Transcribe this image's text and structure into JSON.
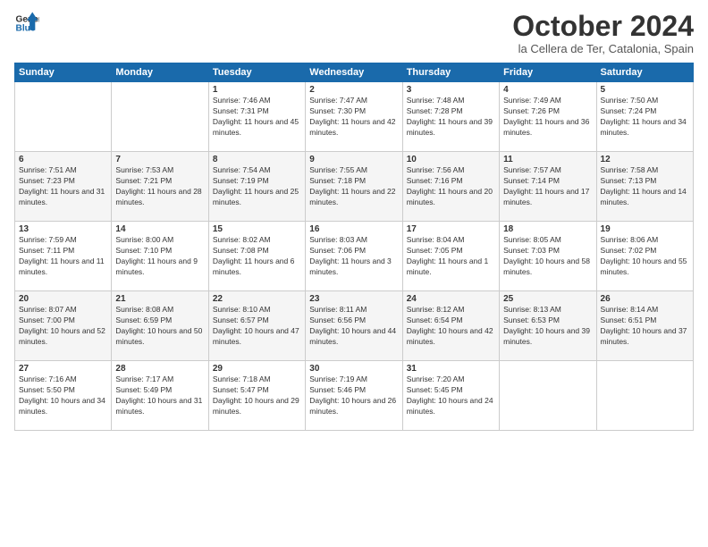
{
  "header": {
    "logo_line1": "General",
    "logo_line2": "Blue",
    "month": "October 2024",
    "location": "la Cellera de Ter, Catalonia, Spain"
  },
  "weekdays": [
    "Sunday",
    "Monday",
    "Tuesday",
    "Wednesday",
    "Thursday",
    "Friday",
    "Saturday"
  ],
  "weeks": [
    [
      {
        "day": "",
        "sunrise": "",
        "sunset": "",
        "daylight": ""
      },
      {
        "day": "",
        "sunrise": "",
        "sunset": "",
        "daylight": ""
      },
      {
        "day": "1",
        "sunrise": "Sunrise: 7:46 AM",
        "sunset": "Sunset: 7:31 PM",
        "daylight": "Daylight: 11 hours and 45 minutes."
      },
      {
        "day": "2",
        "sunrise": "Sunrise: 7:47 AM",
        "sunset": "Sunset: 7:30 PM",
        "daylight": "Daylight: 11 hours and 42 minutes."
      },
      {
        "day": "3",
        "sunrise": "Sunrise: 7:48 AM",
        "sunset": "Sunset: 7:28 PM",
        "daylight": "Daylight: 11 hours and 39 minutes."
      },
      {
        "day": "4",
        "sunrise": "Sunrise: 7:49 AM",
        "sunset": "Sunset: 7:26 PM",
        "daylight": "Daylight: 11 hours and 36 minutes."
      },
      {
        "day": "5",
        "sunrise": "Sunrise: 7:50 AM",
        "sunset": "Sunset: 7:24 PM",
        "daylight": "Daylight: 11 hours and 34 minutes."
      }
    ],
    [
      {
        "day": "6",
        "sunrise": "Sunrise: 7:51 AM",
        "sunset": "Sunset: 7:23 PM",
        "daylight": "Daylight: 11 hours and 31 minutes."
      },
      {
        "day": "7",
        "sunrise": "Sunrise: 7:53 AM",
        "sunset": "Sunset: 7:21 PM",
        "daylight": "Daylight: 11 hours and 28 minutes."
      },
      {
        "day": "8",
        "sunrise": "Sunrise: 7:54 AM",
        "sunset": "Sunset: 7:19 PM",
        "daylight": "Daylight: 11 hours and 25 minutes."
      },
      {
        "day": "9",
        "sunrise": "Sunrise: 7:55 AM",
        "sunset": "Sunset: 7:18 PM",
        "daylight": "Daylight: 11 hours and 22 minutes."
      },
      {
        "day": "10",
        "sunrise": "Sunrise: 7:56 AM",
        "sunset": "Sunset: 7:16 PM",
        "daylight": "Daylight: 11 hours and 20 minutes."
      },
      {
        "day": "11",
        "sunrise": "Sunrise: 7:57 AM",
        "sunset": "Sunset: 7:14 PM",
        "daylight": "Daylight: 11 hours and 17 minutes."
      },
      {
        "day": "12",
        "sunrise": "Sunrise: 7:58 AM",
        "sunset": "Sunset: 7:13 PM",
        "daylight": "Daylight: 11 hours and 14 minutes."
      }
    ],
    [
      {
        "day": "13",
        "sunrise": "Sunrise: 7:59 AM",
        "sunset": "Sunset: 7:11 PM",
        "daylight": "Daylight: 11 hours and 11 minutes."
      },
      {
        "day": "14",
        "sunrise": "Sunrise: 8:00 AM",
        "sunset": "Sunset: 7:10 PM",
        "daylight": "Daylight: 11 hours and 9 minutes."
      },
      {
        "day": "15",
        "sunrise": "Sunrise: 8:02 AM",
        "sunset": "Sunset: 7:08 PM",
        "daylight": "Daylight: 11 hours and 6 minutes."
      },
      {
        "day": "16",
        "sunrise": "Sunrise: 8:03 AM",
        "sunset": "Sunset: 7:06 PM",
        "daylight": "Daylight: 11 hours and 3 minutes."
      },
      {
        "day": "17",
        "sunrise": "Sunrise: 8:04 AM",
        "sunset": "Sunset: 7:05 PM",
        "daylight": "Daylight: 11 hours and 1 minute."
      },
      {
        "day": "18",
        "sunrise": "Sunrise: 8:05 AM",
        "sunset": "Sunset: 7:03 PM",
        "daylight": "Daylight: 10 hours and 58 minutes."
      },
      {
        "day": "19",
        "sunrise": "Sunrise: 8:06 AM",
        "sunset": "Sunset: 7:02 PM",
        "daylight": "Daylight: 10 hours and 55 minutes."
      }
    ],
    [
      {
        "day": "20",
        "sunrise": "Sunrise: 8:07 AM",
        "sunset": "Sunset: 7:00 PM",
        "daylight": "Daylight: 10 hours and 52 minutes."
      },
      {
        "day": "21",
        "sunrise": "Sunrise: 8:08 AM",
        "sunset": "Sunset: 6:59 PM",
        "daylight": "Daylight: 10 hours and 50 minutes."
      },
      {
        "day": "22",
        "sunrise": "Sunrise: 8:10 AM",
        "sunset": "Sunset: 6:57 PM",
        "daylight": "Daylight: 10 hours and 47 minutes."
      },
      {
        "day": "23",
        "sunrise": "Sunrise: 8:11 AM",
        "sunset": "Sunset: 6:56 PM",
        "daylight": "Daylight: 10 hours and 44 minutes."
      },
      {
        "day": "24",
        "sunrise": "Sunrise: 8:12 AM",
        "sunset": "Sunset: 6:54 PM",
        "daylight": "Daylight: 10 hours and 42 minutes."
      },
      {
        "day": "25",
        "sunrise": "Sunrise: 8:13 AM",
        "sunset": "Sunset: 6:53 PM",
        "daylight": "Daylight: 10 hours and 39 minutes."
      },
      {
        "day": "26",
        "sunrise": "Sunrise: 8:14 AM",
        "sunset": "Sunset: 6:51 PM",
        "daylight": "Daylight: 10 hours and 37 minutes."
      }
    ],
    [
      {
        "day": "27",
        "sunrise": "Sunrise: 7:16 AM",
        "sunset": "Sunset: 5:50 PM",
        "daylight": "Daylight: 10 hours and 34 minutes."
      },
      {
        "day": "28",
        "sunrise": "Sunrise: 7:17 AM",
        "sunset": "Sunset: 5:49 PM",
        "daylight": "Daylight: 10 hours and 31 minutes."
      },
      {
        "day": "29",
        "sunrise": "Sunrise: 7:18 AM",
        "sunset": "Sunset: 5:47 PM",
        "daylight": "Daylight: 10 hours and 29 minutes."
      },
      {
        "day": "30",
        "sunrise": "Sunrise: 7:19 AM",
        "sunset": "Sunset: 5:46 PM",
        "daylight": "Daylight: 10 hours and 26 minutes."
      },
      {
        "day": "31",
        "sunrise": "Sunrise: 7:20 AM",
        "sunset": "Sunset: 5:45 PM",
        "daylight": "Daylight: 10 hours and 24 minutes."
      },
      {
        "day": "",
        "sunrise": "",
        "sunset": "",
        "daylight": ""
      },
      {
        "day": "",
        "sunrise": "",
        "sunset": "",
        "daylight": ""
      }
    ]
  ]
}
